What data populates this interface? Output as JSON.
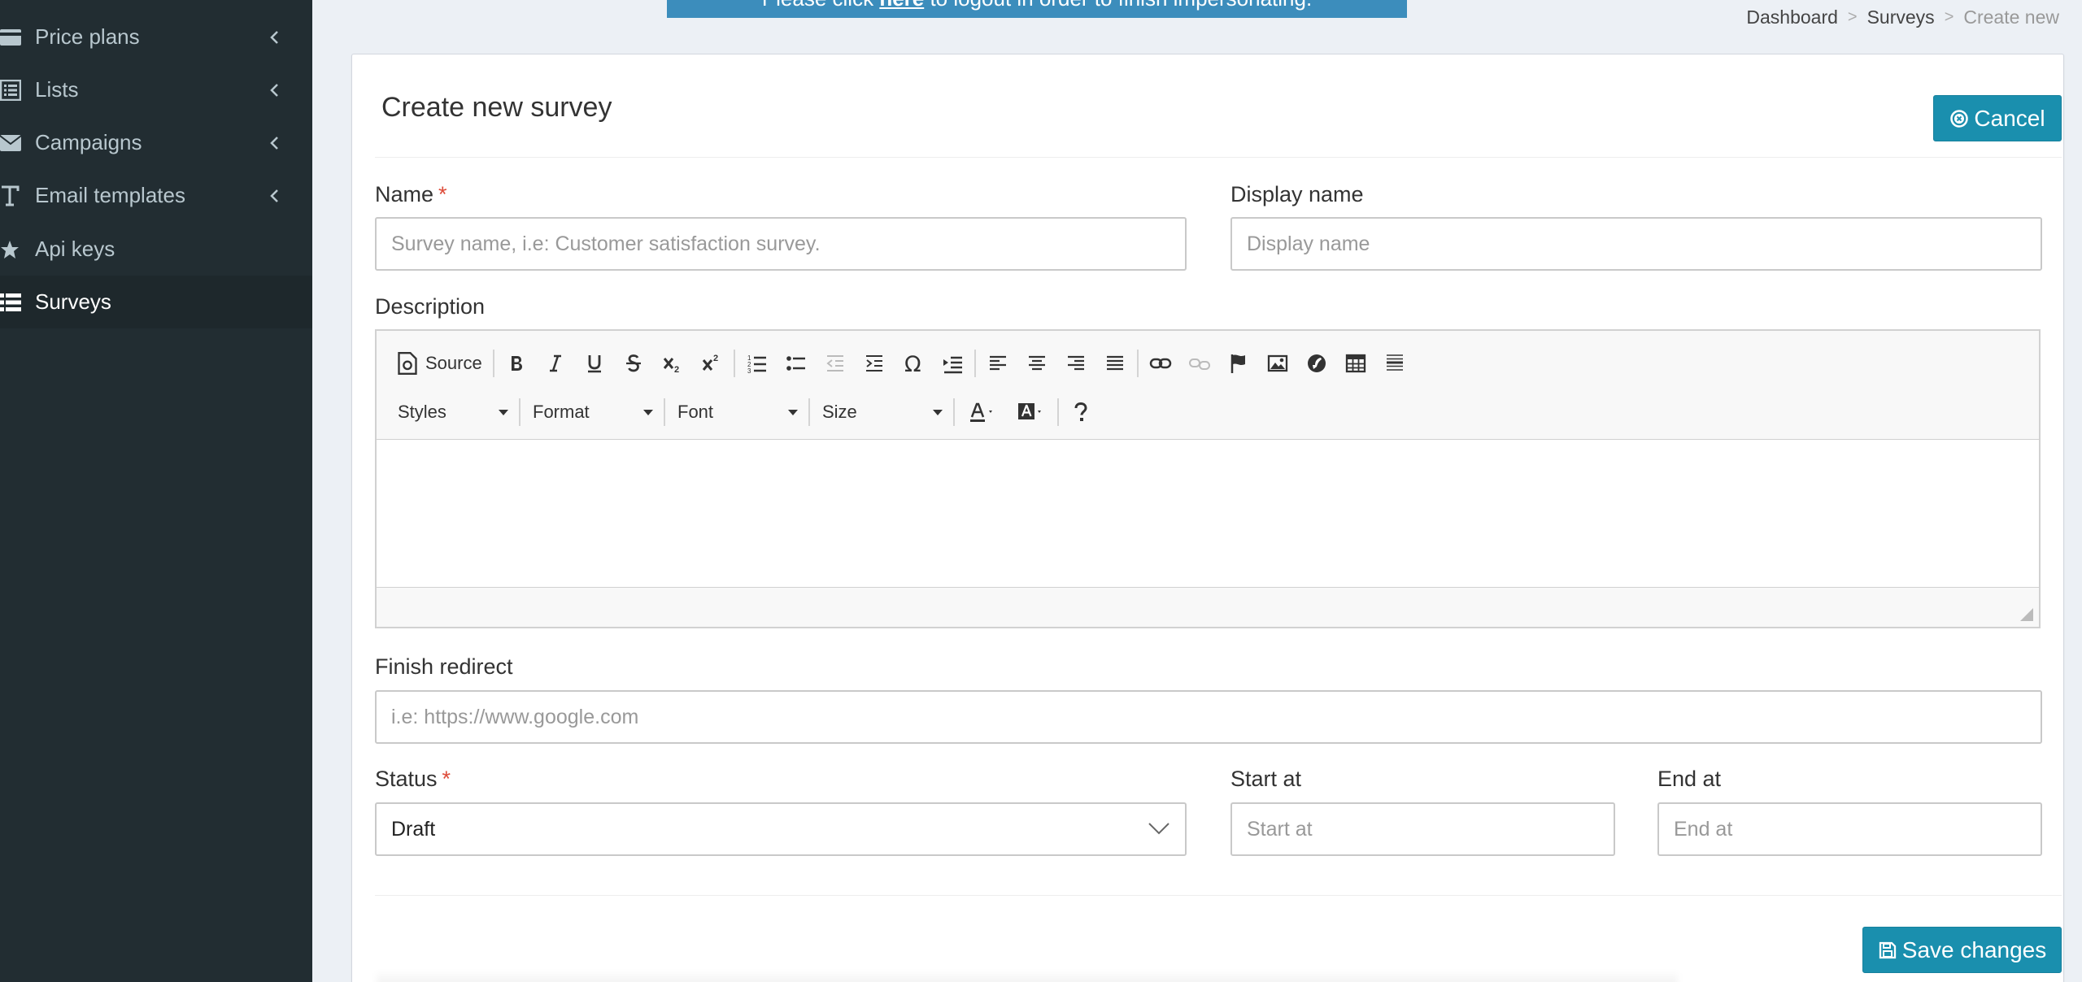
{
  "sidebar": {
    "items": [
      {
        "label": "Price plans",
        "icon": "credit-card-icon",
        "has_chevron": true
      },
      {
        "label": "Lists",
        "icon": "list-alt-icon",
        "has_chevron": true
      },
      {
        "label": "Campaigns",
        "icon": "envelope-icon",
        "has_chevron": true
      },
      {
        "label": "Email templates",
        "icon": "text-icon",
        "has_chevron": true
      },
      {
        "label": "Api keys",
        "icon": "star-icon",
        "has_chevron": false
      },
      {
        "label": "Surveys",
        "icon": "list-icon",
        "has_chevron": false,
        "active": true
      }
    ]
  },
  "notice": {
    "before": "Please click ",
    "link": "here",
    "after": " to logout in order to finish impersonating."
  },
  "breadcrumb": {
    "items": [
      "Dashboard",
      "Surveys",
      "Create new"
    ],
    "separator": ">"
  },
  "form": {
    "title": "Create new survey",
    "cancel_label": "Cancel",
    "name_label": "Name",
    "required_mark": "*",
    "name_placeholder": "Survey name, i.e: Customer satisfaction survey.",
    "display_name_label": "Display name",
    "display_name_placeholder": "Display name",
    "description_label": "Description",
    "finish_redirect_label": "Finish redirect",
    "finish_redirect_placeholder": "i.e: https://www.google.com",
    "status_label": "Status",
    "status_value": "Draft",
    "start_at_label": "Start at",
    "start_at_placeholder": "Start at",
    "end_at_label": "End at",
    "end_at_placeholder": "End at",
    "save_label": "Save changes"
  },
  "editor": {
    "source_label": "Source",
    "styles_label": "Styles",
    "format_label": "Format",
    "font_label": "Font",
    "size_label": "Size"
  },
  "colors": {
    "sidebar_bg": "#222d32",
    "accent": "#1a8fae",
    "notice_bg": "#3c8dbc",
    "required": "#dd4b39"
  }
}
